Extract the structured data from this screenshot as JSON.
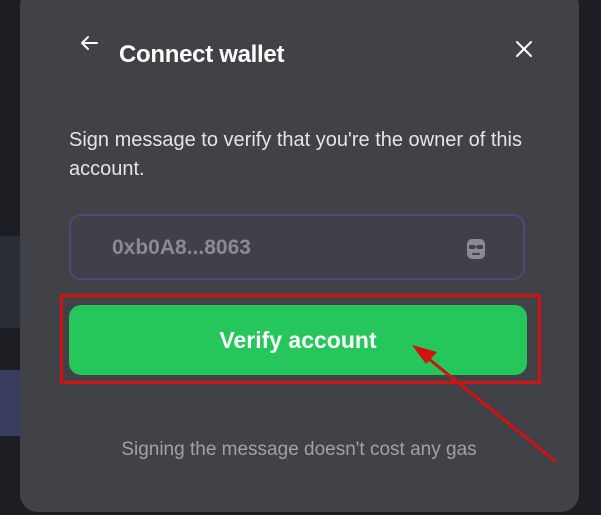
{
  "dialog": {
    "title": "Connect wallet",
    "instructions": "Sign message to verify that you're the owner of this account.",
    "address": "0xb0A8...8063",
    "verify_label": "Verify account",
    "footnote": "Signing the message doesn't cost any gas"
  },
  "icons": {
    "back": "back-arrow-icon",
    "close": "close-icon",
    "avatar": "wallet-avatar-icon"
  },
  "colors": {
    "modal_bg": "#414248",
    "field_border": "#4d4a78",
    "verify_button": "#25c65b",
    "annotation": "#d31111"
  }
}
